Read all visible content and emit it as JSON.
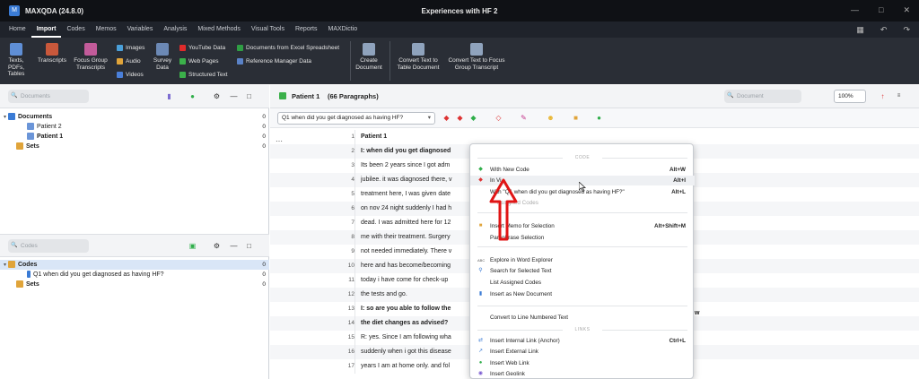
{
  "app": {
    "name": "MAXQDA (24.8.0)",
    "document_title": "Experiences with HF 2"
  },
  "menubar": [
    "Home",
    "Import",
    "Codes",
    "Memos",
    "Variables",
    "Analysis",
    "Mixed Methods",
    "Visual Tools",
    "Reports",
    "MAXDictio"
  ],
  "ribbon": {
    "texts": "Texts, PDFs, Tables",
    "transcripts": "Transcripts",
    "focus": "Focus Group Transcripts",
    "images": "Images",
    "audio": "Audio",
    "videos": "Videos",
    "survey": "Survey Data",
    "youtube": "YouTube Data",
    "webpages": "Web Pages",
    "structured": "Structured Text",
    "excel": "Documents from Excel Spreadsheet",
    "refmgr": "Reference Manager Data",
    "create": "Create Document",
    "convert_table": "Convert Text to Table Document",
    "convert_focus": "Convert Text to Focus Group Transcript"
  },
  "documents_pane": {
    "search_placeholder": "Documents",
    "root": "Documents",
    "root_count": "0",
    "items": [
      {
        "label": "Patient 2",
        "count": "0"
      },
      {
        "label": "Patient 1",
        "count": "0"
      }
    ],
    "sets": "Sets",
    "sets_count": "0"
  },
  "codes_pane": {
    "search_placeholder": "Codes",
    "root": "Codes",
    "root_count": "0",
    "items": [
      {
        "label": "Q1 when did you get diagnosed as having HF?",
        "count": "0"
      }
    ],
    "sets": "Sets",
    "sets_count": "0"
  },
  "document_browser": {
    "title": "Patient 1",
    "paragraphs": "(66 Paragraphs)",
    "search_placeholder": "Document",
    "zoom": "100%",
    "code_selector": "Q1 when did you get diagnosed as having HF?",
    "lines": [
      {
        "no": "1",
        "text": "Patient 1",
        "bold": true
      },
      {
        "no": "2",
        "text": "I: when did you get diagnosed",
        "bold": true
      },
      {
        "no": "3",
        "text": "Its been 2 years since I got adm",
        "bold": false
      },
      {
        "no": "4",
        "text": "jubilee. it was diagnosed there, v",
        "bold": false
      },
      {
        "no": "5",
        "text": "treatment here, I was given date",
        "bold": false
      },
      {
        "no": "6",
        "text": "on nov 24 night suddenly I had h",
        "bold": false
      },
      {
        "no": "7",
        "text": "dead. I was admitted here for 12",
        "bold": false
      },
      {
        "no": "8",
        "text": "me with their treatment. Surgery",
        "bold": false
      },
      {
        "no": "9",
        "text": "not needed immediately. There v",
        "bold": false
      },
      {
        "no": "10",
        "text": "here and has become/becoming",
        "bold": false
      },
      {
        "no": "11",
        "text": "today i have come for check-up",
        "bold": false
      },
      {
        "no": "12",
        "text": "the tests and go.",
        "bold": false
      },
      {
        "no": "13",
        "text": "I: so are you able to follow the",
        "bold": true
      },
      {
        "no": "14",
        "text": "the diet changes as advised?",
        "bold": true
      },
      {
        "no": "15",
        "text": "R: yes. Since I am following wha",
        "bold": false
      },
      {
        "no": "16",
        "text": "suddenly when i got this disease",
        "bold": false
      },
      {
        "no": "17",
        "text": "years I am at home only. and fol",
        "bold": false
      }
    ],
    "trailing_w": "w"
  },
  "context_menu": {
    "code_header": "CODE",
    "links_header": "LINKS",
    "items": [
      {
        "label": "With New Code",
        "shortcut": "Alt+W"
      },
      {
        "label": "In Vi",
        "shortcut": "Alt+I"
      },
      {
        "label": "With \"Q1 when did you get diagnosed as having HF?\"",
        "shortcut": "Alt+L"
      },
      {
        "label": "Assigned Codes",
        "shortcut": ""
      },
      {
        "label": "Insert Memo for Selection",
        "shortcut": "Alt+Shift+M"
      },
      {
        "label": "Paraphrase Selection",
        "shortcut": ""
      },
      {
        "label": "Explore in Word Explorer",
        "shortcut": ""
      },
      {
        "label": "Search for Selected Text",
        "shortcut": ""
      },
      {
        "label": "List Assigned Codes",
        "shortcut": ""
      },
      {
        "label": "Insert as New Document",
        "shortcut": ""
      },
      {
        "label": "Convert to Line Numbered Text",
        "shortcut": ""
      },
      {
        "label": "Insert Internal Link (Anchor)",
        "shortcut": "Ctrl+L"
      },
      {
        "label": "Insert External Link",
        "shortcut": ""
      },
      {
        "label": "Insert Web Link",
        "shortcut": ""
      },
      {
        "label": "Insert Geolink",
        "shortcut": ""
      }
    ]
  },
  "colors": {
    "accent": "#3a7bd5",
    "titlebar": "#0f1115",
    "ribbon": "#2a2e36",
    "annotation": "#e01515"
  }
}
